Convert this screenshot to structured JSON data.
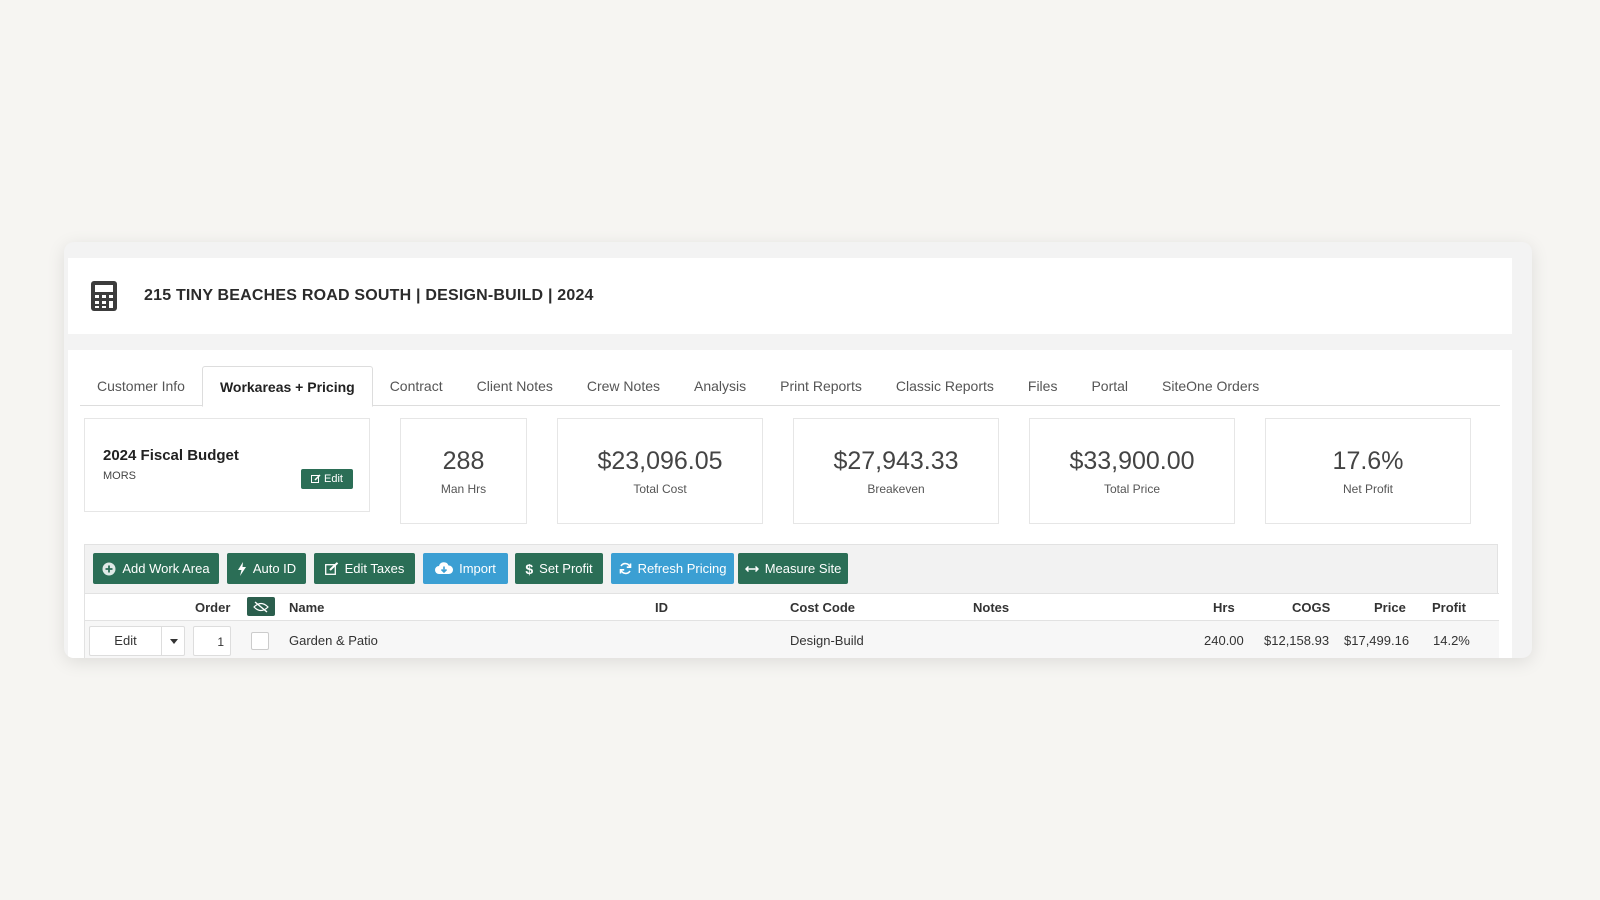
{
  "header": {
    "title": "215 TINY BEACHES ROAD SOUTH | DESIGN-BUILD | 2024",
    "icon": "calculator-icon"
  },
  "tabs": [
    {
      "label": "Customer Info",
      "active": false
    },
    {
      "label": "Workareas + Pricing",
      "active": true
    },
    {
      "label": "Contract",
      "active": false
    },
    {
      "label": "Client Notes",
      "active": false
    },
    {
      "label": "Crew Notes",
      "active": false
    },
    {
      "label": "Analysis",
      "active": false
    },
    {
      "label": "Print Reports",
      "active": false
    },
    {
      "label": "Classic Reports",
      "active": false
    },
    {
      "label": "Files",
      "active": false
    },
    {
      "label": "Portal",
      "active": false
    },
    {
      "label": "SiteOne Orders",
      "active": false
    }
  ],
  "budget": {
    "title": "2024 Fiscal Budget",
    "subtitle": "MORS",
    "edit_label": "Edit"
  },
  "stats": {
    "man_hrs": {
      "value": "288",
      "label": "Man Hrs"
    },
    "total_cost": {
      "value": "$23,096.05",
      "label": "Total Cost"
    },
    "breakeven": {
      "value": "$27,943.33",
      "label": "Breakeven"
    },
    "total_price": {
      "value": "$33,900.00",
      "label": "Total Price"
    },
    "net_profit": {
      "value": "17.6%",
      "label": "Net Profit"
    }
  },
  "toolbar": {
    "add_work_area": "Add Work Area",
    "auto_id": "Auto ID",
    "edit_taxes": "Edit Taxes",
    "import": "Import",
    "set_profit": "Set Profit",
    "refresh_pricing": "Refresh Pricing",
    "measure_site": "Measure Site"
  },
  "table": {
    "columns": {
      "order": "Order",
      "name": "Name",
      "id": "ID",
      "cost_code": "Cost Code",
      "notes": "Notes",
      "hrs": "Hrs",
      "cogs": "COGS",
      "price": "Price",
      "profit": "Profit"
    },
    "rows": [
      {
        "edit_label": "Edit",
        "order": "1",
        "name": "Garden & Patio",
        "id": "",
        "cost_code": "Design-Build",
        "notes": "",
        "hrs": "240.00",
        "cogs": "$12,158.93",
        "price": "$17,499.16",
        "profit": "14.2%"
      }
    ]
  },
  "colors": {
    "primary_green": "#2b6e56",
    "accent_blue": "#3b9fd3"
  }
}
